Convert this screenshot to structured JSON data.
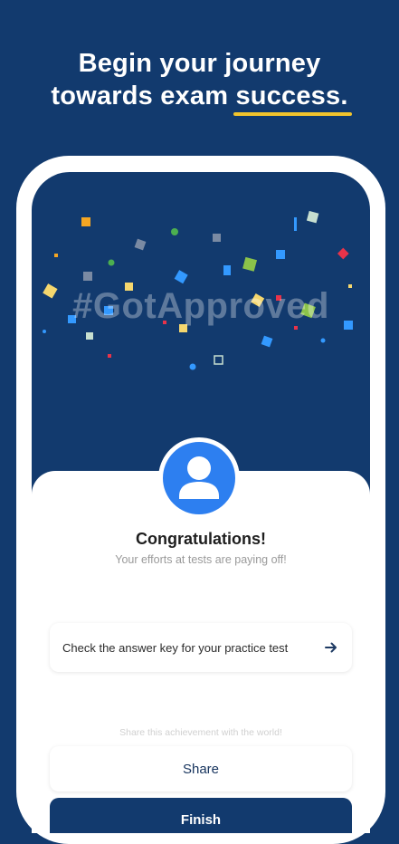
{
  "headline": {
    "line1": "Begin your journey",
    "line2_prefix": "towards exam ",
    "line2_highlight": "success."
  },
  "colors": {
    "background": "#123a6e",
    "accent_underline": "#f2c42c",
    "avatar_blue": "#2d7ff0"
  },
  "celebration": {
    "hashtag": "#GotApproved"
  },
  "result": {
    "title": "Congratulations!",
    "subtitle": "Your efforts at tests are paying off!"
  },
  "answer_key": {
    "label": "Check the answer key for your practice test",
    "icon": "arrow-right-icon"
  },
  "share": {
    "hint": "Share this achievement with the world!",
    "button_label": "Share"
  },
  "finish": {
    "button_label": "Finish"
  },
  "avatar": {
    "icon": "user-icon"
  }
}
